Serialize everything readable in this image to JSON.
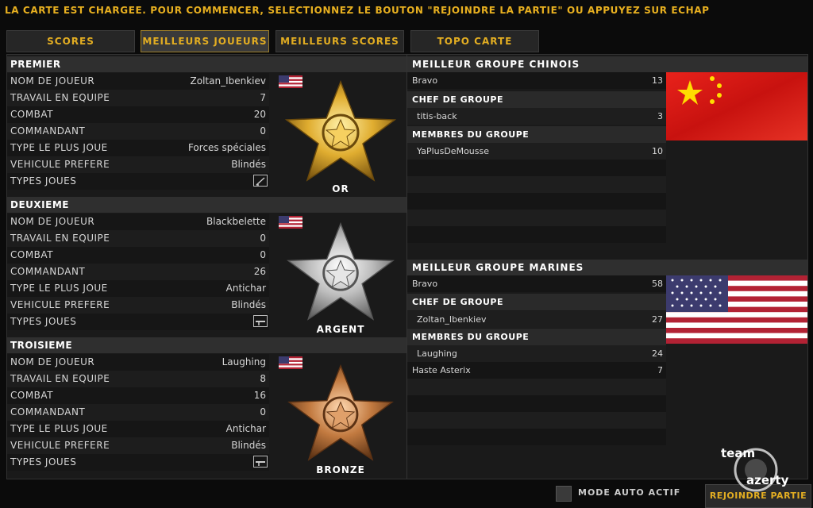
{
  "top_message": "LA CARTE EST CHARGEE. POUR COMMENCER, SELECTIONNEZ LE BOUTON \"REJOINDRE LA PARTIE\" OU APPUYEZ SUR ECHAP",
  "tabs": [
    {
      "label": "SCORES",
      "active": false
    },
    {
      "label": "MEILLEURS JOUEURS",
      "active": true
    },
    {
      "label": "MEILLEURS SCORES",
      "active": false
    },
    {
      "label": "TOPO CARTE",
      "active": false
    }
  ],
  "labels": {
    "player_name": "NOM DE JOUEUR",
    "teamwork": "TRAVAIL EN EQUIPE",
    "combat": "COMBAT",
    "commander": "COMMANDANT",
    "most_played": "TYPE LE PLUS JOUE",
    "fav_vehicle": "VEHICULE PREFERE",
    "types_played": "TYPES JOUES"
  },
  "ranks": [
    {
      "title": "PREMIER",
      "medal": "OR",
      "name": "Zoltan_Ibenkiev",
      "teamwork": "7",
      "combat": "20",
      "commander": "0",
      "most_played": "Forces spéciales",
      "vehicle": "Blindés",
      "medal_color": "#e3b53b"
    },
    {
      "title": "DEUXIEME",
      "medal": "ARGENT",
      "name": "Blackbelette",
      "teamwork": "0",
      "combat": "0",
      "commander": "26",
      "most_played": "Antichar",
      "vehicle": "Blindés",
      "medal_color": "#c9c9c9"
    },
    {
      "title": "TROISIEME",
      "medal": "BRONZE",
      "name": "Laughing",
      "teamwork": "8",
      "combat": "16",
      "commander": "0",
      "most_played": "Antichar",
      "vehicle": "Blindés",
      "medal_color": "#c8804a"
    }
  ],
  "groups": [
    {
      "title": "MEILLEUR GROUPE CHINOIS",
      "squad": "Bravo",
      "squad_score": "13",
      "leader_label": "CHEF DE GROUPE",
      "leader": "titis-back",
      "leader_score": "3",
      "members_label": "MEMBRES DU GROUPE",
      "members": [
        {
          "name": "YaPlusDeMousse",
          "score": "10"
        }
      ]
    },
    {
      "title": "MEILLEUR GROUPE MARINES",
      "squad": "Bravo",
      "squad_score": "58",
      "leader_label": "CHEF DE GROUPE",
      "leader": "Zoltan_Ibenkiev",
      "leader_score": "27",
      "members_label": "MEMBRES DU GROUPE",
      "members": [
        {
          "name": "Laughing",
          "score": "24"
        },
        {
          "name": "Haste Asterix",
          "score": "7"
        }
      ]
    }
  ],
  "bottom": {
    "auto_label": "MODE AUTO ACTIF",
    "join_label": "REJOINDRE PARTIE"
  },
  "logo_text": "team azerty"
}
